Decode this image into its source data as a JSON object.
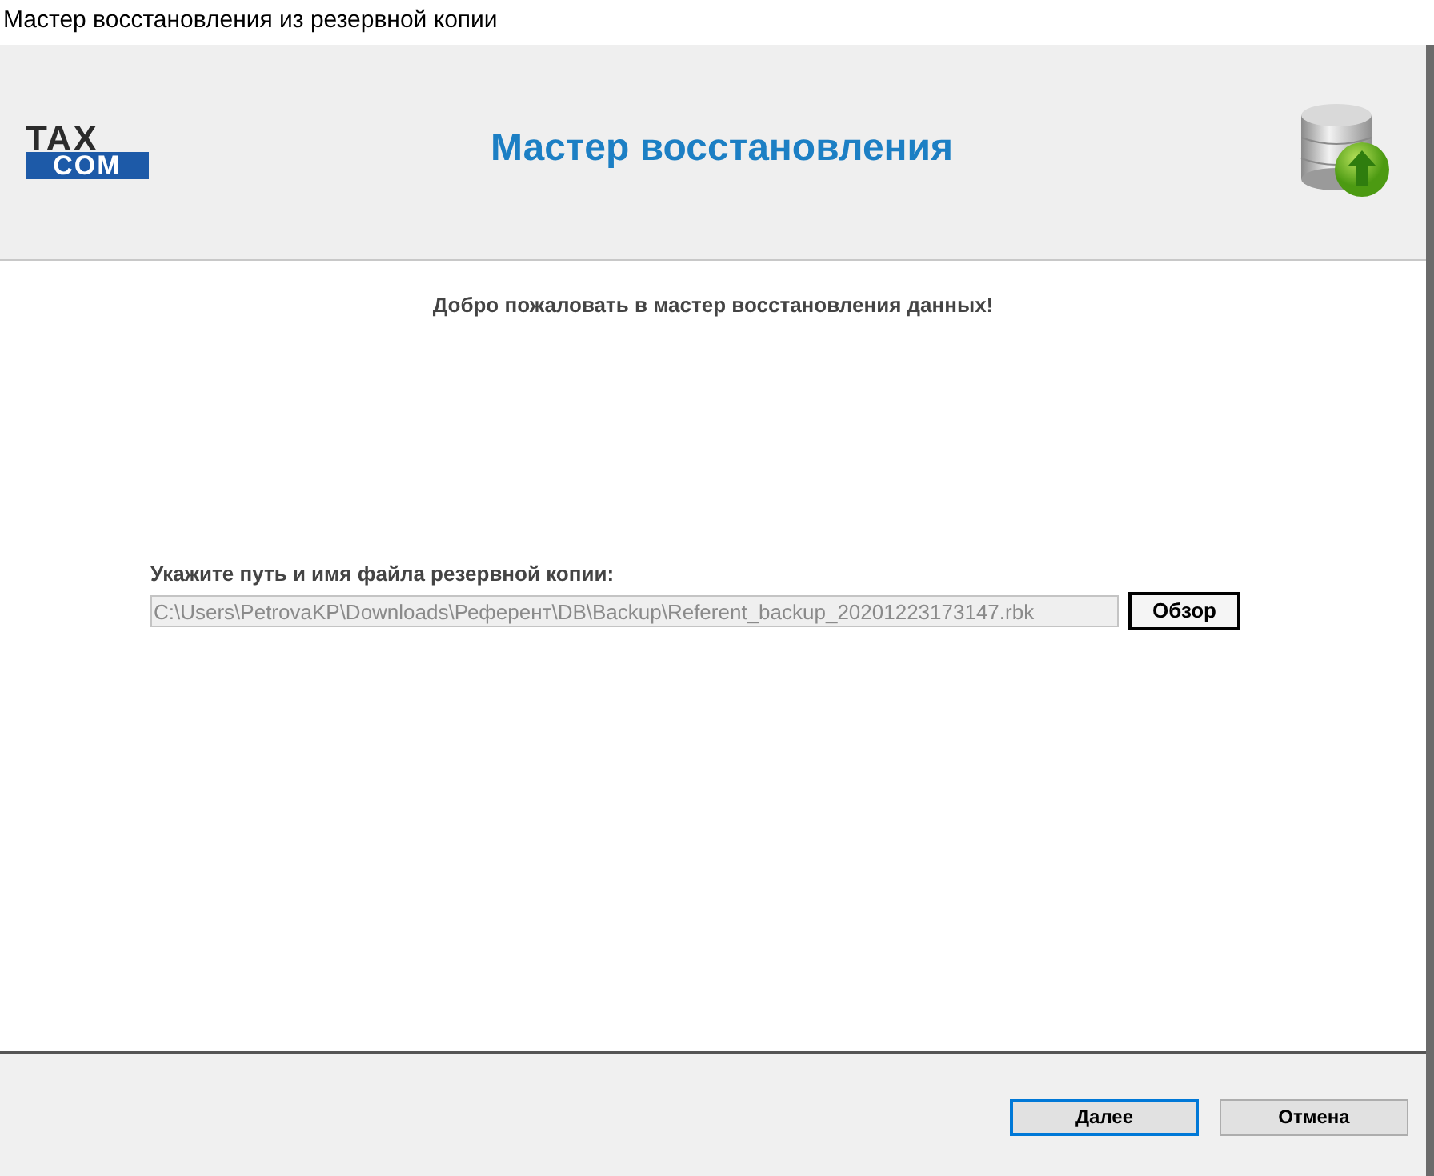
{
  "window": {
    "title": "Мастер восстановления из резервной копии"
  },
  "header": {
    "logo": {
      "top": "TAX",
      "bottom": "COM"
    },
    "title": "Мастер восстановления"
  },
  "welcome": "Добро пожаловать в мастер восстановления данных!",
  "file": {
    "label": "Укажите путь и имя файла резервной копии:",
    "value": "C:\\Users\\PetrovaKP\\Downloads\\Референт\\DB\\Backup\\Referent_backup_20201223173147.rbk",
    "disabled": true,
    "browse": "Обзор"
  },
  "buttons": [
    {
      "label": "Далее",
      "default": true
    },
    {
      "label": "Отмена",
      "default": false
    }
  ]
}
